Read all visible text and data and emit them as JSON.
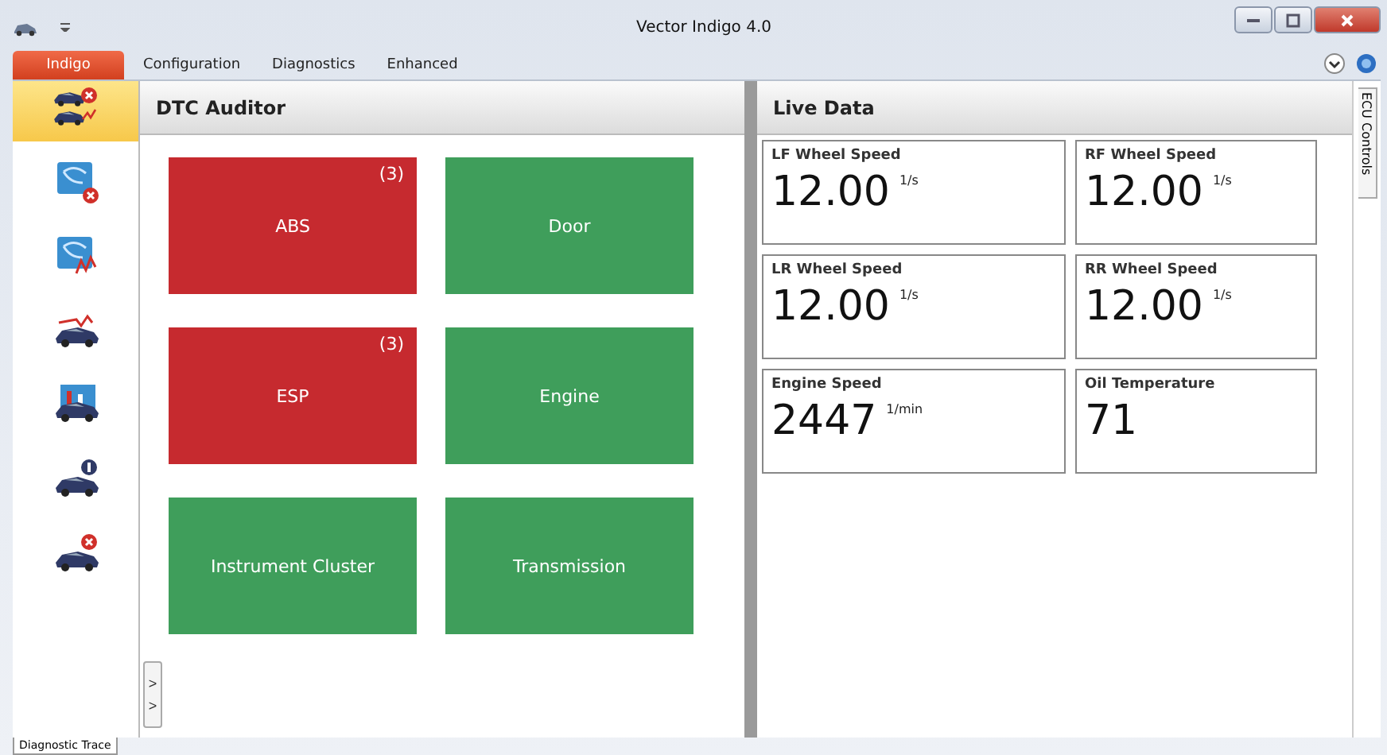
{
  "window": {
    "title": "Vector Indigo 4.0"
  },
  "ribbon_tabs": [
    {
      "label": "Indigo",
      "selected": true
    },
    {
      "label": "Configuration",
      "selected": false
    },
    {
      "label": "Diagnostics",
      "selected": false
    },
    {
      "label": "Enhanced",
      "selected": false
    }
  ],
  "sidebar": {
    "items": [
      {
        "kind": "car-chart",
        "selected": true
      },
      {
        "kind": "network-error",
        "selected": false
      },
      {
        "kind": "network-chart",
        "selected": false
      },
      {
        "kind": "car-graph",
        "selected": false
      },
      {
        "kind": "car-panel",
        "selected": false
      },
      {
        "kind": "car-info",
        "selected": false
      },
      {
        "kind": "car-error",
        "selected": false
      }
    ]
  },
  "dtc_auditor": {
    "title": "DTC Auditor",
    "expander": "> >",
    "tiles": [
      {
        "name": "ABS",
        "count": "(3)",
        "fault": true
      },
      {
        "name": "Door",
        "fault": false
      },
      {
        "name": "ESP",
        "count": "(3)",
        "fault": true
      },
      {
        "name": "Engine",
        "fault": false
      },
      {
        "name": "Instrument Cluster",
        "fault": false
      },
      {
        "name": "Transmission",
        "fault": false
      }
    ]
  },
  "live_data": {
    "title": "Live Data",
    "signals": [
      {
        "label": "LF Wheel Speed",
        "value": "12.00",
        "unit": "1/s"
      },
      {
        "label": "RF Wheel Speed",
        "value": "12.00",
        "unit": "1/s"
      },
      {
        "label": "LR Wheel Speed",
        "value": "12.00",
        "unit": "1/s"
      },
      {
        "label": "RR Wheel Speed",
        "value": "12.00",
        "unit": "1/s"
      },
      {
        "label": "Engine Speed",
        "value": "2447",
        "unit": "1/min"
      },
      {
        "label": "Oil Temperature",
        "value": "71"
      }
    ]
  },
  "side_tab": "ECU Controls",
  "bottom_tab": "Diagnostic Trace"
}
